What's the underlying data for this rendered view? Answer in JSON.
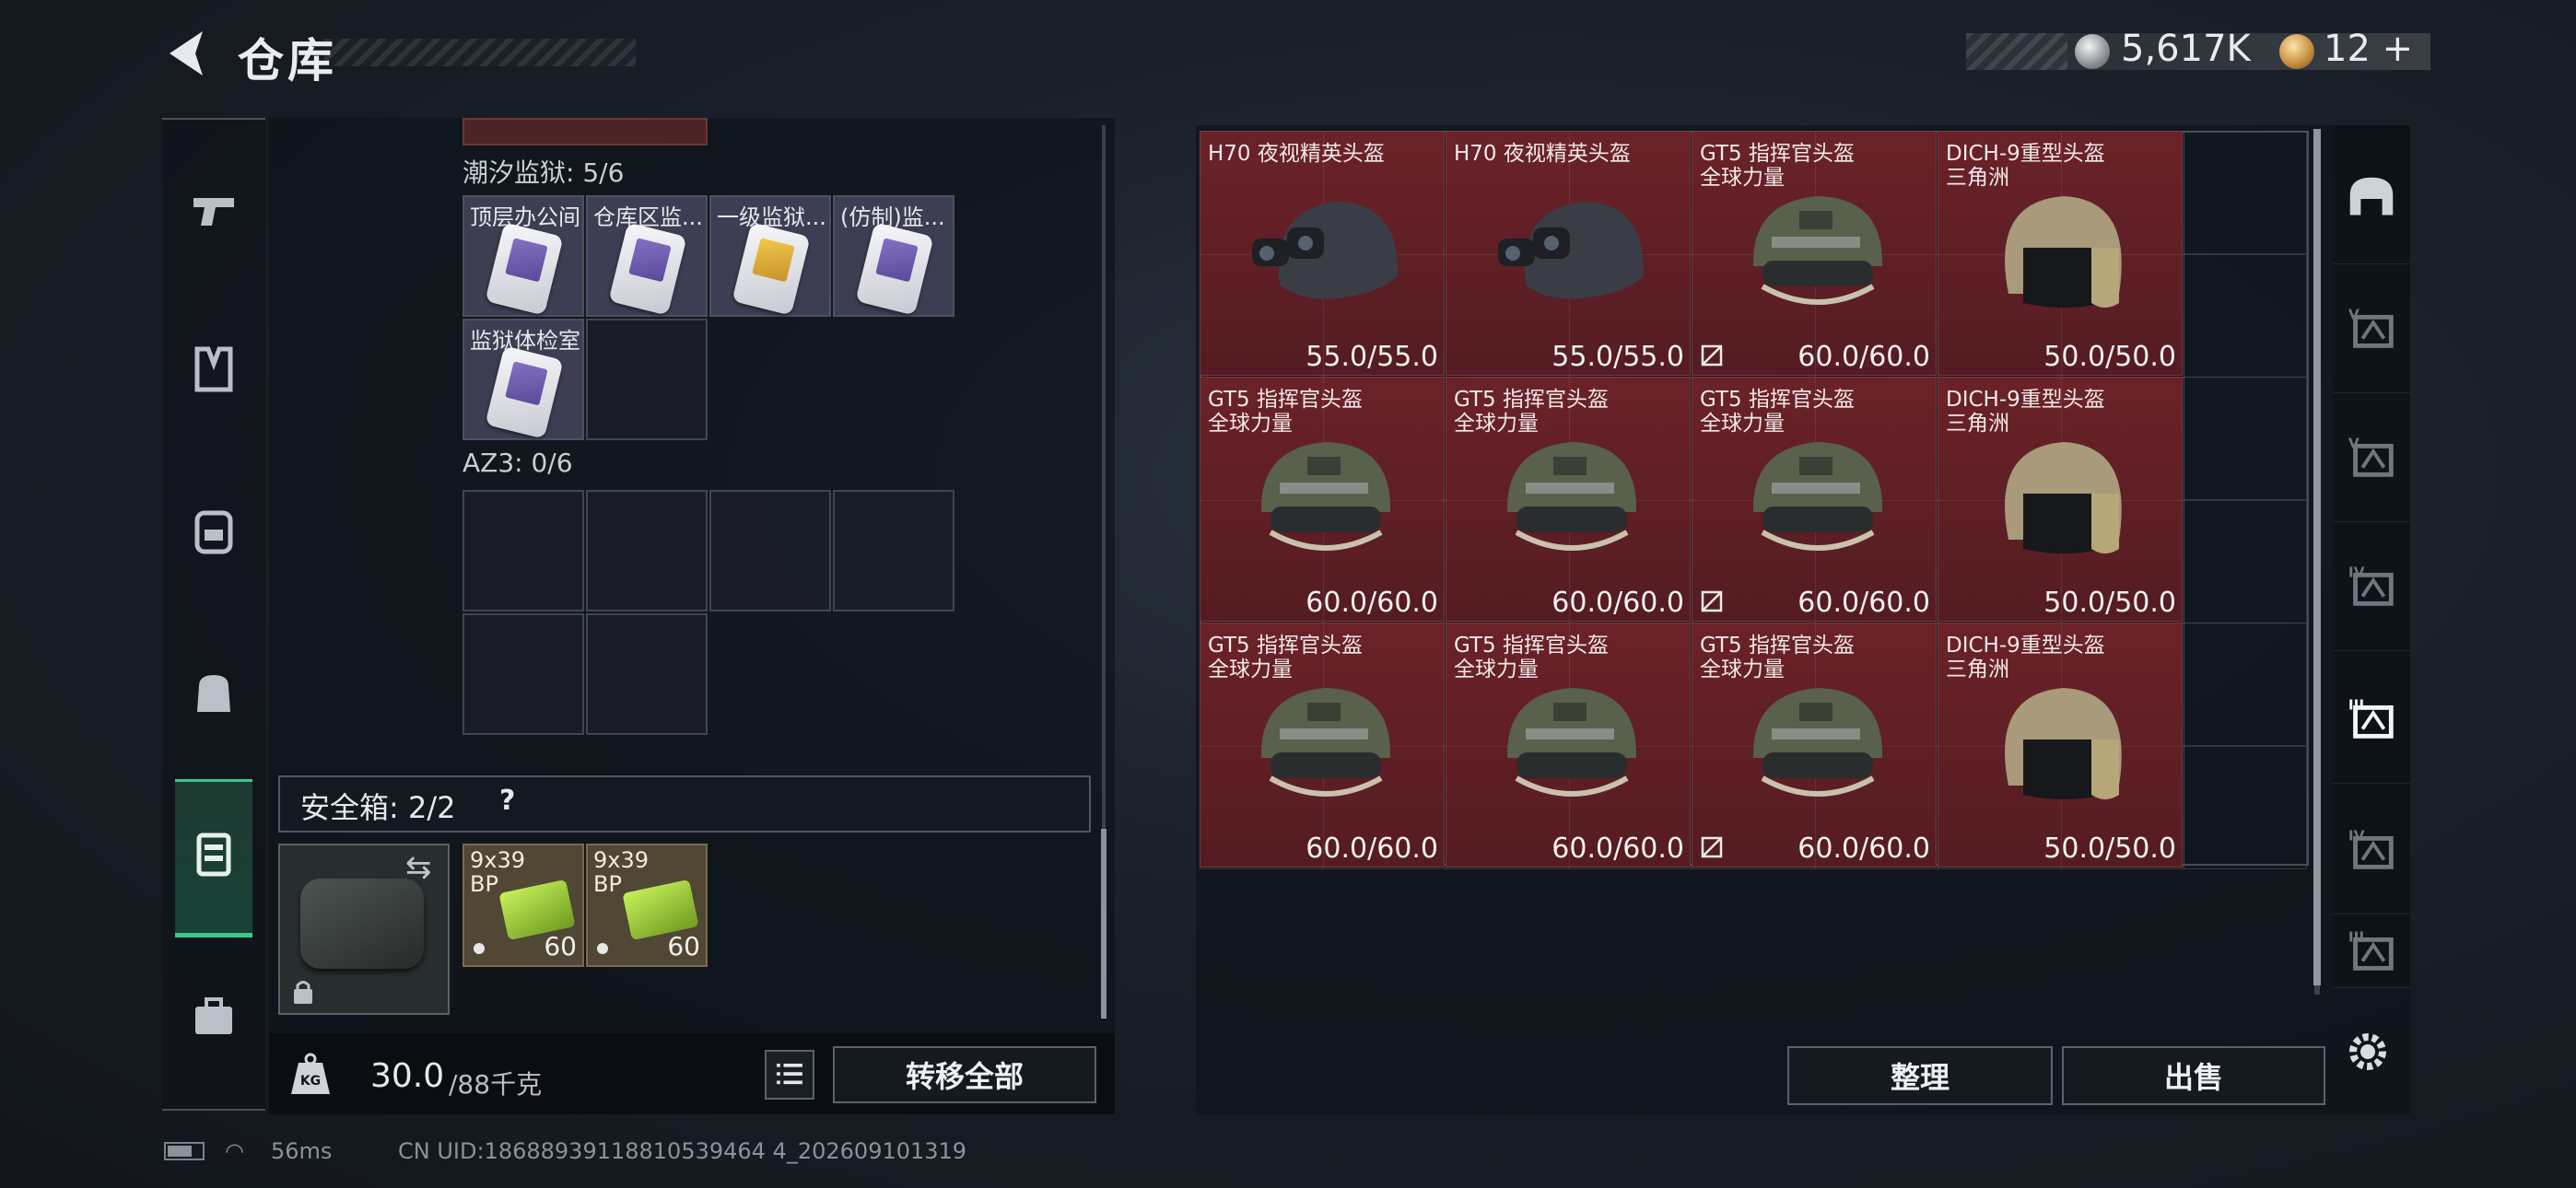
{
  "header": {
    "title": "仓库",
    "currency1": "5,617K",
    "currency2": "12 +",
    "colors": {
      "accent": "#39c98a",
      "item_red": "#5e1e24"
    }
  },
  "categories": [
    {
      "name": "pistol-icon"
    },
    {
      "name": "vest-icon"
    },
    {
      "name": "backpack-icon"
    },
    {
      "name": "bag-icon"
    },
    {
      "name": "safebox-icon",
      "active": true
    },
    {
      "name": "toolbox-icon"
    }
  ],
  "left": {
    "tide_prison_label": "潮汐监狱: 5/6",
    "keys": [
      "顶层办公间",
      "仓库区监...",
      "一级监狱...",
      "(仿制)监...",
      "监狱体检室"
    ],
    "az3_label": "AZ3: 0/6",
    "safe_label": "安全箱: 2/2",
    "safe_help": "?",
    "ammo": [
      {
        "t1": "9x39",
        "t2": "BP",
        "qty": "60"
      },
      {
        "t1": "9x39",
        "t2": "BP",
        "qty": "60"
      }
    ],
    "weight_value": "30.0",
    "weight_cap": "/88千克",
    "transfer_all": "转移全部"
  },
  "stash": {
    "items": [
      {
        "n1": "H70 夜视精英头盔",
        "n2": "",
        "dur": "55.0/55.0",
        "notrade": false,
        "type": "nvg"
      },
      {
        "n1": "H70 夜视精英头盔",
        "n2": "",
        "dur": "55.0/55.0",
        "notrade": false,
        "type": "nvg"
      },
      {
        "n1": "GT5 指挥官头盔",
        "n2": "全球力量",
        "dur": "60.0/60.0",
        "notrade": true,
        "type": "gt5"
      },
      {
        "n1": "DICH-9重型头盔",
        "n2": "三角洲",
        "dur": "50.0/50.0",
        "notrade": false,
        "type": "dich"
      },
      {
        "n1": "GT5 指挥官头盔",
        "n2": "全球力量",
        "dur": "60.0/60.0",
        "notrade": false,
        "type": "gt5"
      },
      {
        "n1": "GT5 指挥官头盔",
        "n2": "全球力量",
        "dur": "60.0/60.0",
        "notrade": false,
        "type": "gt5"
      },
      {
        "n1": "GT5 指挥官头盔",
        "n2": "全球力量",
        "dur": "60.0/60.0",
        "notrade": true,
        "type": "gt5"
      },
      {
        "n1": "DICH-9重型头盔",
        "n2": "三角洲",
        "dur": "50.0/50.0",
        "notrade": false,
        "type": "dich"
      },
      {
        "n1": "GT5 指挥官头盔",
        "n2": "全球力量",
        "dur": "60.0/60.0",
        "notrade": false,
        "type": "gt5"
      },
      {
        "n1": "GT5 指挥官头盔",
        "n2": "全球力量",
        "dur": "60.0/60.0",
        "notrade": false,
        "type": "gt5"
      },
      {
        "n1": "GT5 指挥官头盔",
        "n2": "全球力量",
        "dur": "60.0/60.0",
        "notrade": true,
        "type": "gt5"
      },
      {
        "n1": "DICH-9重型头盔",
        "n2": "三角洲",
        "dur": "50.0/50.0",
        "notrade": false,
        "type": "dich"
      }
    ],
    "sort": "整理",
    "sell": "出售"
  },
  "side_filters": [
    {
      "name": "helmet-filter-icon",
      "label": ""
    },
    {
      "name": "v-helmet-filter-icon",
      "label": "V"
    },
    {
      "name": "v-helmet-filter-icon-2",
      "label": "V"
    },
    {
      "name": "iv-helmet-filter-icon",
      "label": "IV"
    },
    {
      "name": "iii-helmet-filter-icon",
      "label": "III",
      "active": true
    },
    {
      "name": "iv-armor-filter-icon",
      "label": "IV"
    },
    {
      "name": "iii-armor-filter-icon",
      "label": "III"
    }
  ],
  "status": {
    "ping": "56ms",
    "uid": "CN UID:18688939118810539464 4_202609101319"
  }
}
